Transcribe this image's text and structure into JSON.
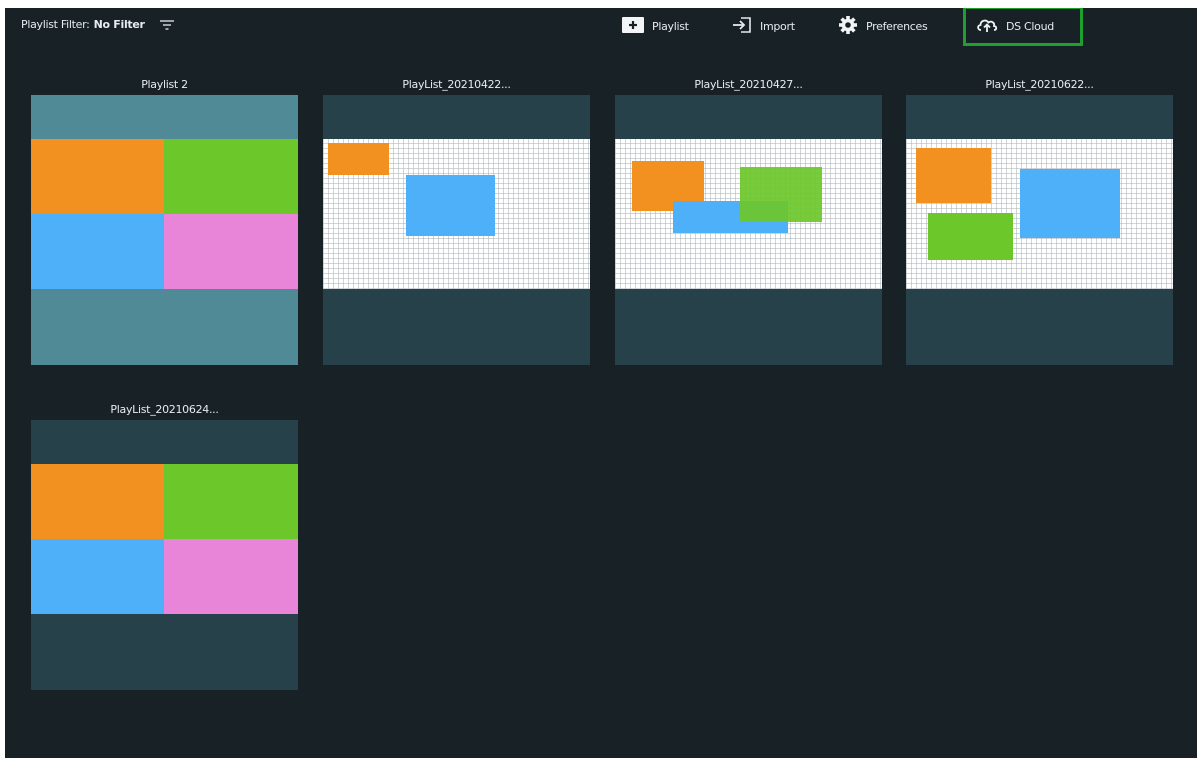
{
  "toolbar": {
    "filter_label": "Playlist Filter:",
    "filter_value": "No Filter",
    "add_playlist_label": "Playlist",
    "import_label": "Import",
    "preferences_label": "Preferences",
    "cloud_label": "DS Cloud"
  },
  "playlists": [
    {
      "title": "Playlist 2"
    },
    {
      "title": "PlayList_20210422..."
    },
    {
      "title": "PlayList_20210427..."
    },
    {
      "title": "PlayList_20210622..."
    },
    {
      "title": "PlayList_20210624..."
    }
  ],
  "colors": {
    "background": "#172126",
    "highlight_border": "#1ea02e",
    "orange": "#f39120",
    "green": "#6cc72a",
    "blue": "#4db0f8",
    "pink": "#e985d8",
    "teal_band": "#508a97",
    "dark_band": "#27414a"
  }
}
